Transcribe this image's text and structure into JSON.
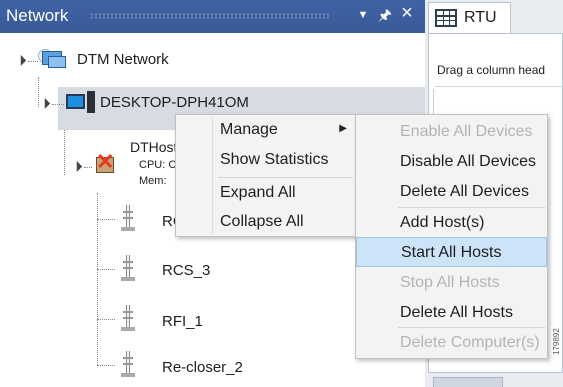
{
  "network_panel": {
    "title": "Network",
    "dropdown_icon": "chevron-down-icon",
    "pin_icon": "pin-icon",
    "close_icon": "close-icon"
  },
  "tree": {
    "root": {
      "label": "DTM Network",
      "icon": "network-icon"
    },
    "computer": {
      "label": "DESKTOP-DPH41OM",
      "icon": "computer-icon"
    },
    "host": {
      "label": "DTHost",
      "cpu_label": "CPU: C",
      "mem_label": "Mem:",
      "icon": "host-error-icon"
    },
    "devices": [
      {
        "label": "RC",
        "icon": "device-icon"
      },
      {
        "label": "RCS_3",
        "icon": "device-icon"
      },
      {
        "label": "RFI_1",
        "icon": "device-icon"
      },
      {
        "label": "Re-closer_2",
        "icon": "device-icon"
      }
    ]
  },
  "rtu_panel": {
    "tab_label": "RTU",
    "tab_icon": "grid-icon",
    "drag_hint": "Drag a column head"
  },
  "context_menu": {
    "items": [
      {
        "label": "Manage",
        "has_submenu": true
      },
      {
        "label": "Show Statistics"
      },
      {
        "label": "Expand All"
      },
      {
        "label": "Collapse All"
      }
    ]
  },
  "submenu": {
    "items": [
      {
        "label": "Enable All Devices",
        "disabled": true
      },
      {
        "label": "Disable All Devices",
        "disabled": false
      },
      {
        "label": "Delete All Devices",
        "disabled": false
      },
      {
        "label": "Add Host(s)",
        "disabled": false
      },
      {
        "label": "Start All Hosts",
        "disabled": false,
        "highlighted": true
      },
      {
        "label": "Stop All Hosts",
        "disabled": true
      },
      {
        "label": "Delete All Hosts",
        "disabled": false
      },
      {
        "label": "Delete Computer(s)",
        "disabled": true
      }
    ]
  },
  "figure_id": "179892",
  "colors": {
    "header": "#3a5a98",
    "selection": "#d7dce3",
    "menu_background": "#f3f3f3",
    "menu_highlight": "#cde3f7",
    "disabled_text": "#b4b4b4"
  }
}
